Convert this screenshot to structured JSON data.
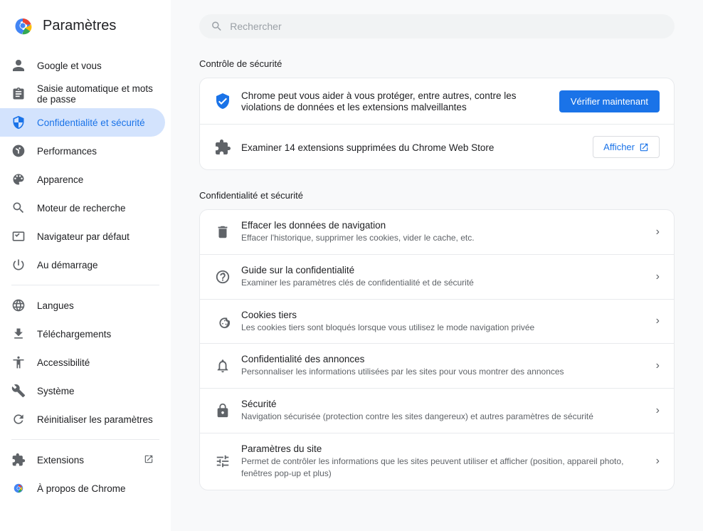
{
  "sidebar": {
    "title": "Paramètres",
    "search_placeholder": "Rechercher",
    "items": [
      {
        "id": "google",
        "label": "Google et vous",
        "icon": "person"
      },
      {
        "id": "autofill",
        "label": "Saisie automatique et mots de passe",
        "icon": "clipboard"
      },
      {
        "id": "privacy",
        "label": "Confidentialité et sécurité",
        "icon": "shield",
        "active": true
      },
      {
        "id": "performances",
        "label": "Performances",
        "icon": "speedometer"
      },
      {
        "id": "appearance",
        "label": "Apparence",
        "icon": "palette"
      },
      {
        "id": "search_engine",
        "label": "Moteur de recherche",
        "icon": "search"
      },
      {
        "id": "default_browser",
        "label": "Navigateur par défaut",
        "icon": "monitor"
      },
      {
        "id": "startup",
        "label": "Au démarrage",
        "icon": "power"
      }
    ],
    "items2": [
      {
        "id": "languages",
        "label": "Langues",
        "icon": "globe"
      },
      {
        "id": "downloads",
        "label": "Téléchargements",
        "icon": "download"
      },
      {
        "id": "accessibility",
        "label": "Accessibilité",
        "icon": "accessibility"
      },
      {
        "id": "system",
        "label": "Système",
        "icon": "wrench"
      },
      {
        "id": "reset",
        "label": "Réinitialiser les paramètres",
        "icon": "reset"
      }
    ],
    "items3": [
      {
        "id": "extensions",
        "label": "Extensions",
        "icon": "puzzle",
        "external": true
      },
      {
        "id": "about",
        "label": "À propos de Chrome",
        "icon": "chrome"
      }
    ]
  },
  "main": {
    "security_section_title": "Contrôle de sécurité",
    "security_check": {
      "description": "Chrome peut vous aider à vous protéger, entre autres, contre les violations de données et les extensions malveillantes",
      "button_label": "Vérifier maintenant"
    },
    "extensions_check": {
      "label": "Examiner 14 extensions supprimées du Chrome Web Store",
      "button_label": "Afficher"
    },
    "privacy_section_title": "Confidentialité et sécurité",
    "privacy_items": [
      {
        "id": "clear-data",
        "title": "Effacer les données de navigation",
        "subtitle": "Effacer l'historique, supprimer les cookies, vider le cache, etc.",
        "icon": "trash"
      },
      {
        "id": "privacy-guide",
        "title": "Guide sur la confidentialité",
        "subtitle": "Examiner les paramètres clés de confidentialité et de sécurité",
        "icon": "privacy-guide"
      },
      {
        "id": "third-party-cookies",
        "title": "Cookies tiers",
        "subtitle": "Les cookies tiers sont bloqués lorsque vous utilisez le mode navigation privée",
        "icon": "cookie"
      },
      {
        "id": "ads-privacy",
        "title": "Confidentialité des annonces",
        "subtitle": "Personnaliser les informations utilisées par les sites pour vous montrer des annonces",
        "icon": "ads"
      },
      {
        "id": "security",
        "title": "Sécurité",
        "subtitle": "Navigation sécurisée (protection contre les sites dangereux) et autres paramètres de sécurité",
        "icon": "security"
      },
      {
        "id": "site-settings",
        "title": "Paramètres du site",
        "subtitle": "Permet de contrôler les informations que les sites peuvent utiliser et afficher (position, appareil photo, fenêtres pop-up et plus)",
        "icon": "sliders"
      }
    ]
  }
}
